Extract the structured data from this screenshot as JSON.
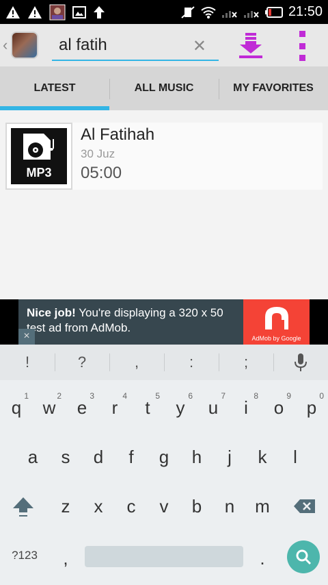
{
  "status_bar": {
    "time": "21:50",
    "left_icons": [
      "warning-icon",
      "warning-icon",
      "app-notification-icon",
      "image-icon",
      "upload-arrow-icon"
    ],
    "right_icons": [
      "vibrate-off-icon",
      "wifi-icon",
      "signal-icon",
      "signal-icon",
      "battery-icon"
    ]
  },
  "action_bar": {
    "search_value": "al fatih",
    "clear_icon": "close-icon",
    "download_icon": "download-icon",
    "menu_icon": "overflow-menu-icon",
    "accent": "#c02bd6"
  },
  "tabs": [
    {
      "label": "LATEST",
      "active": true
    },
    {
      "label": "ALL MUSIC",
      "active": false
    },
    {
      "label": "MY FAVORITES",
      "active": false
    }
  ],
  "list": [
    {
      "thumb_label": "MP3",
      "title": "Al Fatihah",
      "subtitle": "30 Juz",
      "duration": "05:00"
    }
  ],
  "ad": {
    "bold": "Nice job!",
    "text": " You're displaying a 320 x 50 test ad from AdMob.",
    "brand": "AdMob by Google",
    "close": "×"
  },
  "keyboard": {
    "suggestions": [
      "!",
      "?",
      ",",
      ":",
      ";"
    ],
    "row1": [
      {
        "k": "q",
        "n": "1"
      },
      {
        "k": "w",
        "n": "2"
      },
      {
        "k": "e",
        "n": "3"
      },
      {
        "k": "r",
        "n": "4"
      },
      {
        "k": "t",
        "n": "5"
      },
      {
        "k": "y",
        "n": "6"
      },
      {
        "k": "u",
        "n": "7"
      },
      {
        "k": "i",
        "n": "8"
      },
      {
        "k": "o",
        "n": "9"
      },
      {
        "k": "p",
        "n": "0"
      }
    ],
    "row2": [
      "a",
      "s",
      "d",
      "f",
      "g",
      "h",
      "j",
      "k",
      "l"
    ],
    "row3": [
      "z",
      "x",
      "c",
      "v",
      "b",
      "n",
      "m"
    ],
    "symbols_label": "?123",
    "comma": ",",
    "period": "."
  },
  "colors": {
    "tab_indicator": "#33b5e5",
    "ad_bg": "#37474f",
    "ad_logo": "#f44336",
    "enter": "#4db6ac"
  }
}
